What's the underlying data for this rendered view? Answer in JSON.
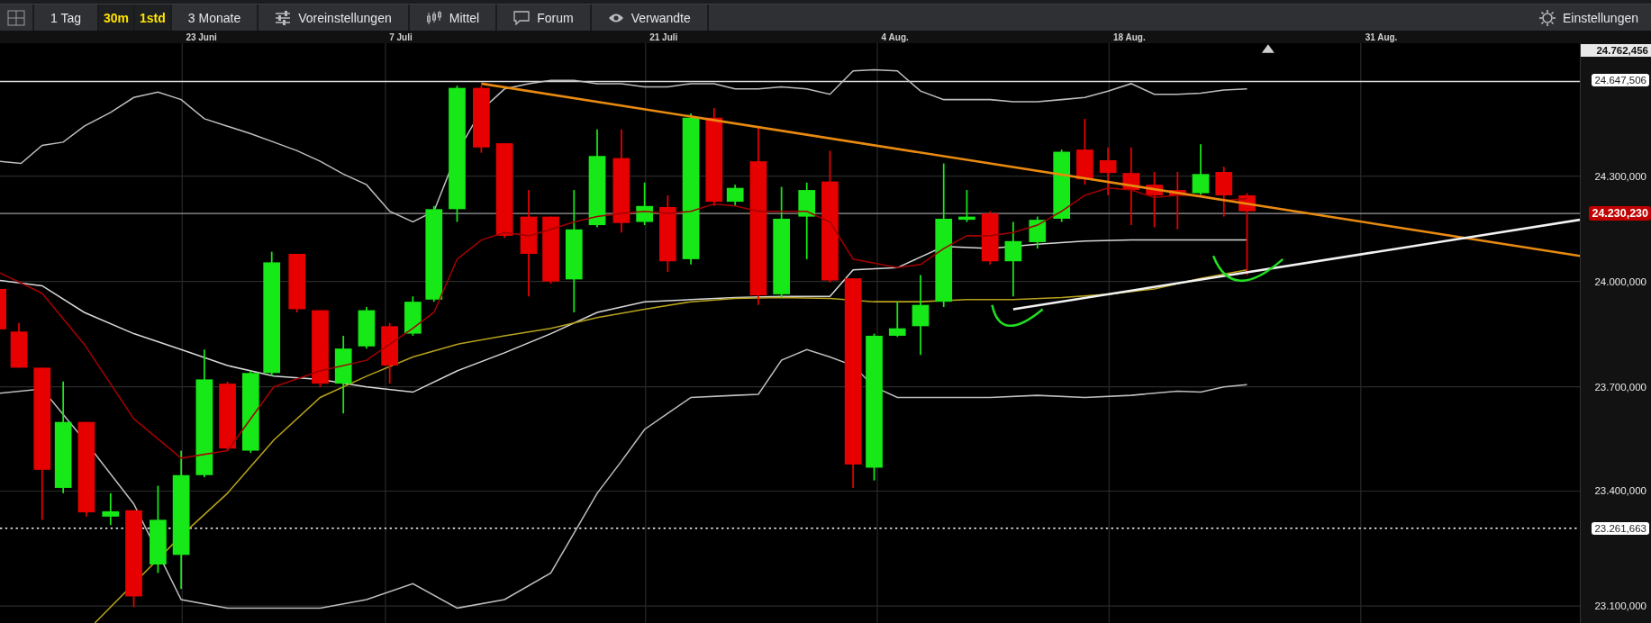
{
  "toolbar": {
    "items": [
      {
        "kind": "layout",
        "selected": false
      },
      {
        "kind": "text",
        "label": "1 Tag",
        "selected": false
      },
      {
        "kind": "interval",
        "label": "30m",
        "selected": true
      },
      {
        "kind": "interval",
        "label": "1std",
        "selected": true
      },
      {
        "kind": "text",
        "label": "3 Monate",
        "selected": false
      },
      {
        "kind": "presets",
        "label": "Voreinstellungen",
        "selected": false
      },
      {
        "kind": "indicators",
        "label": "Mittel",
        "selected": false
      },
      {
        "kind": "forum",
        "label": "Forum",
        "selected": false
      },
      {
        "kind": "related",
        "label": "Verwandte",
        "selected": false
      }
    ],
    "settings": {
      "label": "Einstellungen"
    }
  },
  "chart": {
    "date_labels": [
      "23 Juni",
      "7 Juli",
      "21 Juli",
      "4 Aug.",
      "18 Aug.",
      "31 Aug."
    ],
    "price_labels": [
      {
        "label": "24.762,456",
        "kind": "high"
      },
      {
        "label": "24.647,506",
        "kind": "line"
      },
      {
        "label": "24.300,000",
        "kind": "tick"
      },
      {
        "label": "24.230,230",
        "kind": "last"
      },
      {
        "label": "24.000,000",
        "kind": "tick"
      },
      {
        "label": "23.700,000",
        "kind": "tick"
      },
      {
        "label": "23.400,000",
        "kind": "tick"
      },
      {
        "label": "23.261,663",
        "kind": "line"
      },
      {
        "label": "23.100,000",
        "kind": "tick"
      }
    ]
  }
}
